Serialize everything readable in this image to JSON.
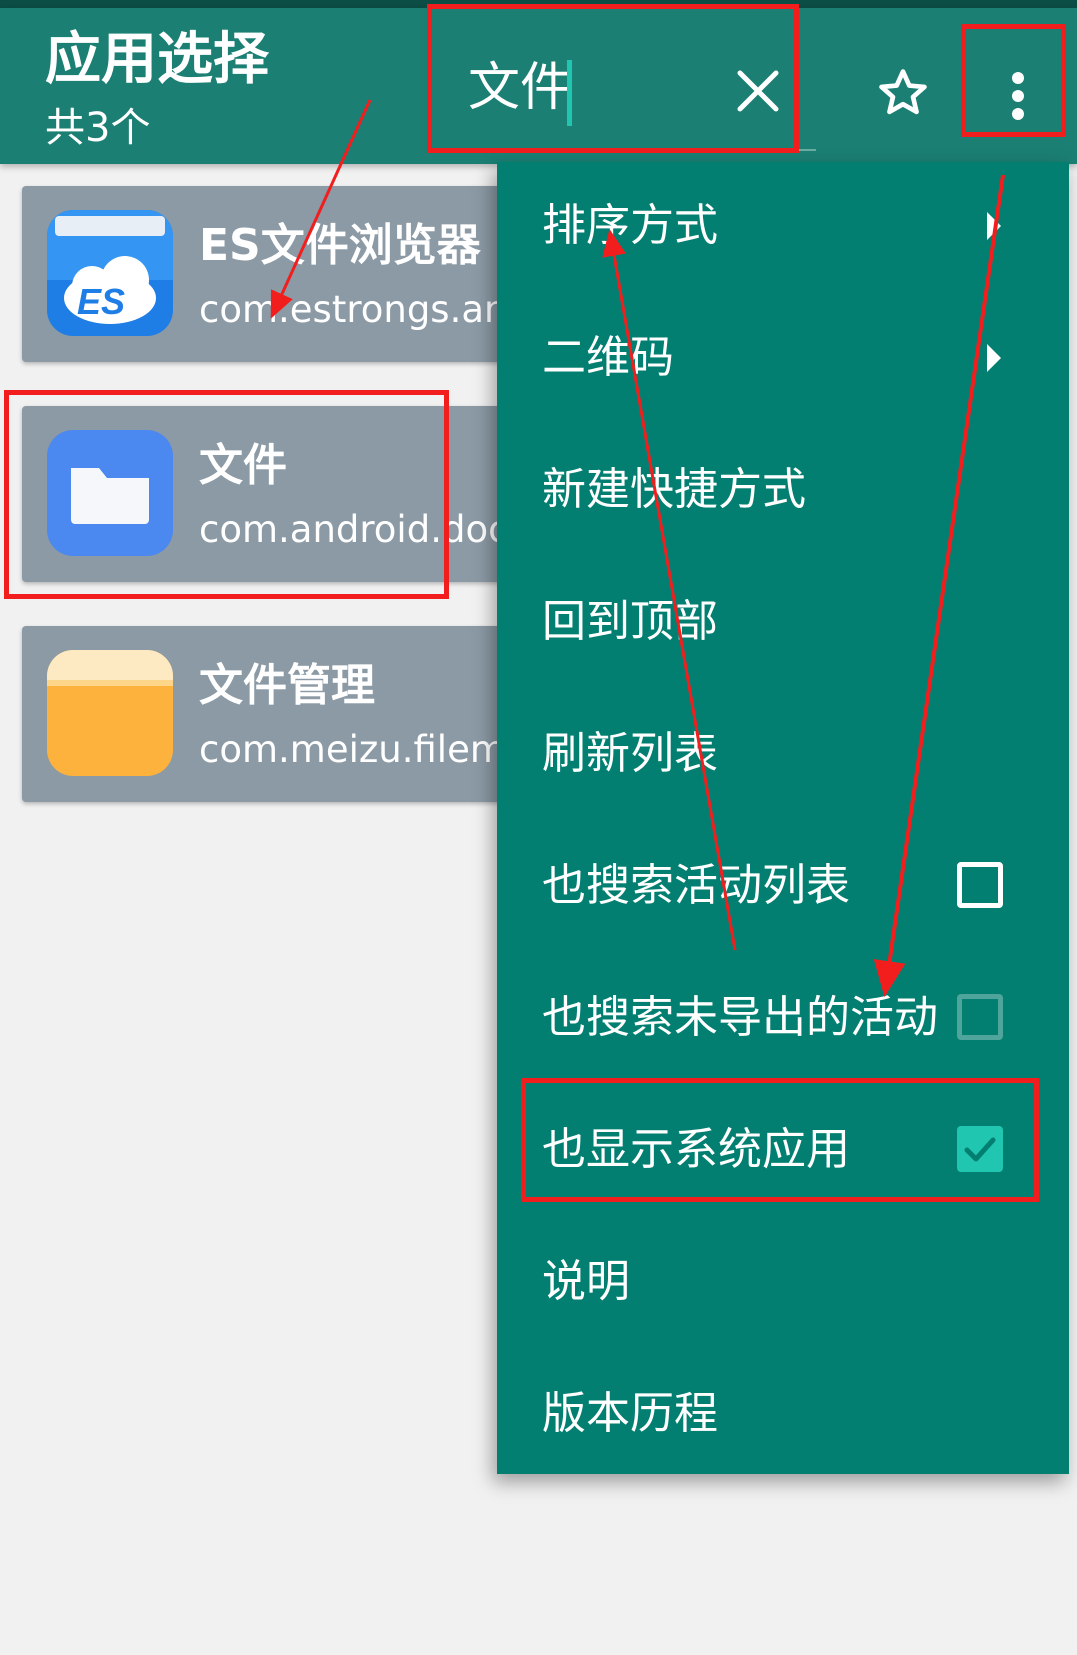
{
  "appbar": {
    "title": "应用选择",
    "subtitle": "共3个",
    "search_value": "文件",
    "icons": {
      "close": "close-icon",
      "star": "star-outline-icon",
      "more": "more-vert-icon"
    }
  },
  "apps": [
    {
      "name": "ES文件浏览器",
      "package": "com.estrongs.and",
      "icon": "es-file-explorer-icon"
    },
    {
      "name": "文件",
      "package": "com.android.docu",
      "icon": "folder-icon"
    },
    {
      "name": "文件管理",
      "package": "com.meizu.filema",
      "icon": "file-manager-icon"
    }
  ],
  "menu": {
    "items": [
      {
        "label": "排序方式",
        "trailing": "submenu-arrow"
      },
      {
        "label": "二维码",
        "trailing": "submenu-arrow"
      },
      {
        "label": "新建快捷方式"
      },
      {
        "label": "回到顶部"
      },
      {
        "label": "刷新列表"
      },
      {
        "label": "也搜索活动列表",
        "checked": false
      },
      {
        "label": "也搜索未导出的活动",
        "checked": false,
        "disabled": true
      },
      {
        "label": "也显示系统应用",
        "checked": true
      },
      {
        "label": "说明"
      },
      {
        "label": "版本历程"
      }
    ]
  },
  "colors": {
    "appbar": "#1b7f73",
    "menu": "#037f72",
    "card": "#8b9aa5",
    "accent": "#21c6b0",
    "annotation": "#f21e1e"
  }
}
